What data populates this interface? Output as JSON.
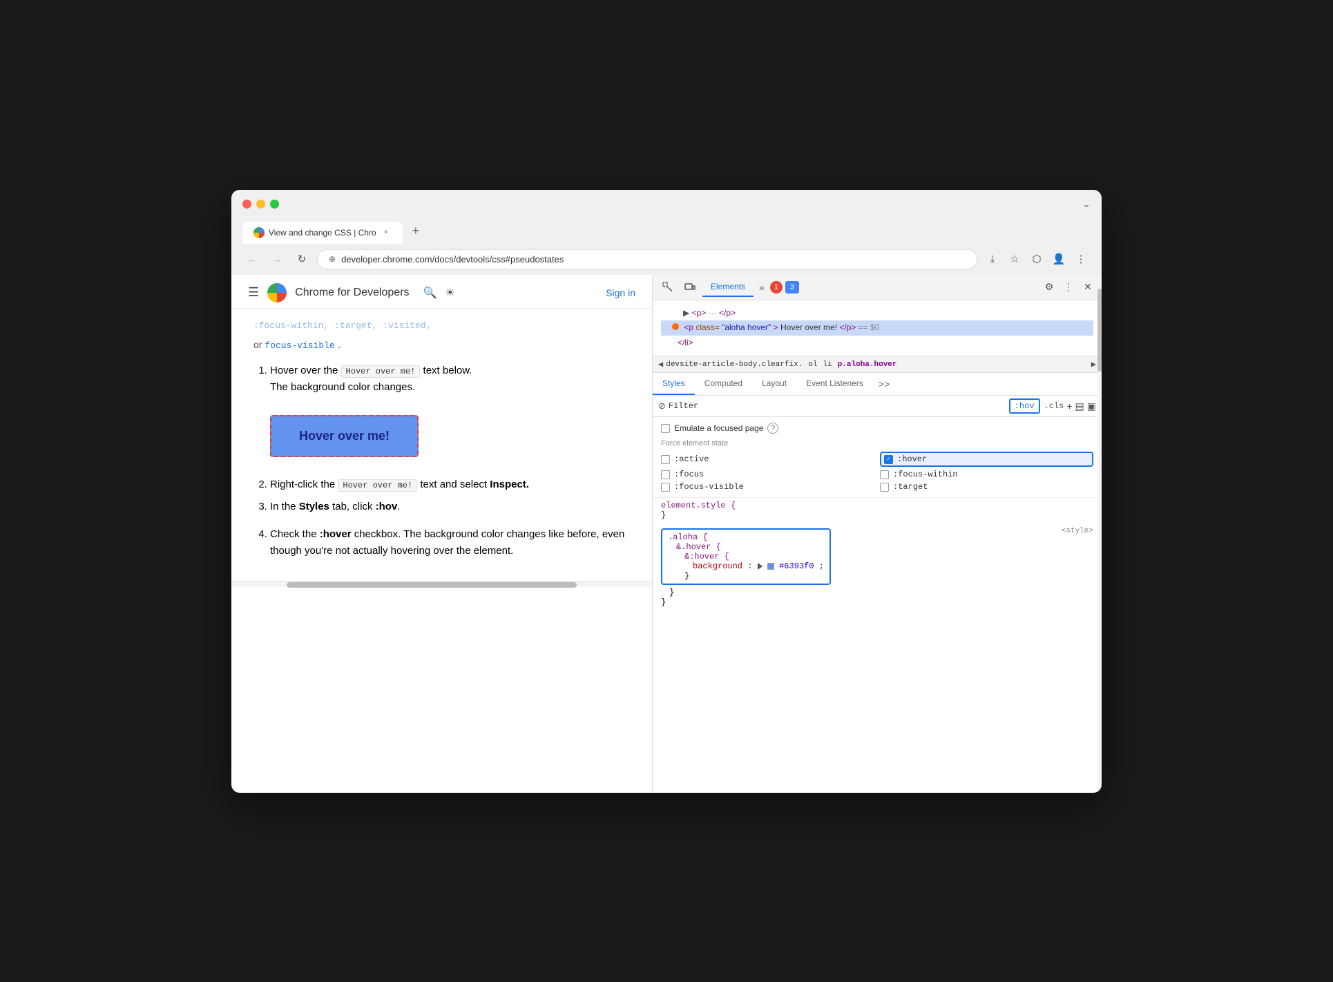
{
  "browser": {
    "traffic_lights": [
      "red",
      "yellow",
      "green"
    ],
    "tab": {
      "title": "View and change CSS | Chro",
      "close_label": "×"
    },
    "new_tab_label": "+",
    "chevron_label": "⌄",
    "address": {
      "url": "developer.chrome.com/docs/devtools/css#pseudostates",
      "icon": "⊕"
    },
    "nav": {
      "back": "←",
      "forward": "→",
      "reload": "↻"
    }
  },
  "article": {
    "site_name": "Chrome for Developers",
    "header_search_label": "🔍",
    "header_theme_label": "☀",
    "sign_in_label": "Sign in",
    "blur_text": ":focus-within, :target, :visited,",
    "focus_visible_text": "focus-visible",
    "steps": [
      {
        "num": 1,
        "text_before": "Hover over the ",
        "code": "Hover over me!",
        "text_after": " text below. The background color changes."
      },
      {
        "num": 2,
        "text_before": "Right-click the ",
        "code": "Hover over me!",
        "text_after": " text and select ",
        "bold": "Inspect."
      },
      {
        "num": 3,
        "text_before": "In the ",
        "bold_styles": "Styles",
        "text_after": " tab, click :hov."
      },
      {
        "num": 4,
        "text_before": "Check the ",
        "bold": ":hover",
        "text_after": " checkbox. The background color changes like before, even though you're not actually hovering over the element."
      }
    ],
    "hover_box_label": "Hover over me!"
  },
  "devtools": {
    "toolbar": {
      "cursor_icon": "⬚",
      "device_icon": "▭",
      "elements_tab": "Elements",
      "more_tabs": "»",
      "error_count": "1",
      "comment_count": "3",
      "gear_icon": "⚙",
      "more_icon": "⋮",
      "close_icon": "✕"
    },
    "dom": {
      "lines": [
        {
          "indent": 1,
          "content": "▶ <p> ··· </p>",
          "selected": false
        },
        {
          "indent": 1,
          "content": "<p class=\"aloha hover\">Hover over me!</p> == $0",
          "selected": true,
          "has_dot": true
        },
        {
          "indent": 1,
          "content": "</li>",
          "selected": false
        }
      ]
    },
    "breadcrumb": {
      "left_arrow": "◀",
      "right_arrow": "▶",
      "items": [
        "devsite-article-body.clearfix.",
        "ol",
        "li",
        "p.aloha.hover"
      ]
    },
    "styles_tabs": [
      "Styles",
      "Computed",
      "Layout",
      "Event Listeners",
      ">>"
    ],
    "filter": {
      "icon": "⊘",
      "placeholder": "Filter",
      "hov_label": ":hov",
      "cls_label": ".cls",
      "add_label": "+",
      "new_style_icon": "▤",
      "sidebar_icon": "▣"
    },
    "emulate": {
      "label": "Emulate a focused page",
      "info_label": "?"
    },
    "force_state": {
      "label": "Force element state",
      "states": [
        {
          "id": "active",
          "label": ":active",
          "checked": false,
          "col": 1
        },
        {
          "id": "hover",
          "label": ":hover",
          "checked": true,
          "col": 2
        },
        {
          "id": "focus",
          "label": ":focus",
          "checked": false,
          "col": 1
        },
        {
          "id": "focus-within",
          "label": ":focus-within",
          "checked": false,
          "col": 2
        },
        {
          "id": "focus-visible",
          "label": ":focus-visible",
          "checked": false,
          "col": 1
        },
        {
          "id": "target",
          "label": ":target",
          "checked": false,
          "col": 2
        }
      ]
    },
    "css_rules": [
      {
        "id": "element-style",
        "selector": "element.style {",
        "close": "}",
        "properties": []
      },
      {
        "id": "aloha-rule",
        "highlighted": true,
        "source": "<style>",
        "lines": [
          ".aloha {",
          "  &.hover {",
          "    &:hover {",
          "      background: ▶ ■ #6393f0;",
          "    }",
          "  }",
          "}"
        ]
      }
    ]
  }
}
